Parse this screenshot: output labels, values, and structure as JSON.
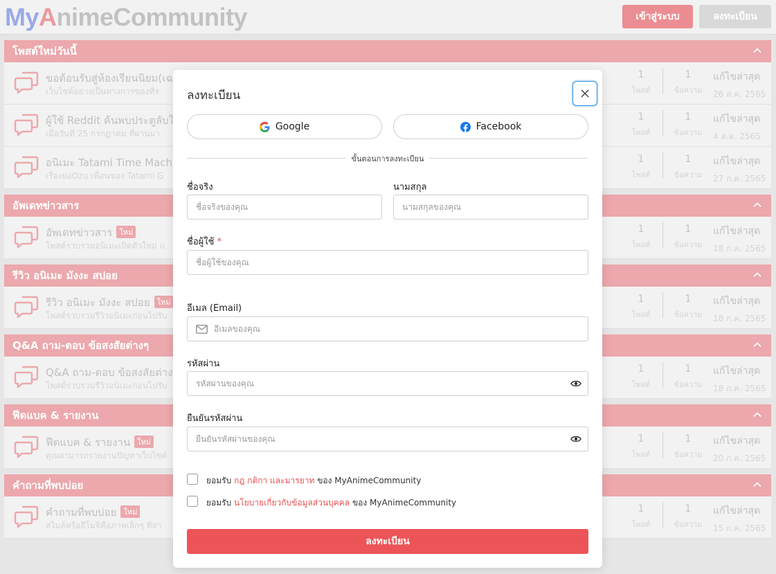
{
  "header": {
    "logo_part1": "My",
    "logo_part2": "A",
    "logo_part3": "nimeCommunity",
    "login_label": "เข้าสู่ระบบ",
    "register_label": "ลงทะเบียน"
  },
  "sections": [
    {
      "title": "โพสต์ใหม่วันนี้",
      "rows": [
        {
          "title": "ขอต้อนรับสู่ห้องเรียนนิยม(เฉ",
          "badge": "",
          "desc": "เว็บไซต์อย่างเป็นทางการของที่ร",
          "posts": "1",
          "posts_label": "โพสต์",
          "msgs": "1",
          "msgs_label": "ข้อความ",
          "last_label": "แก้ไขล่าสุด",
          "date": "26 ส.ค. 2565"
        },
        {
          "title": "ผู้ใช้ Reddit ค้นพบประตูลับใ",
          "badge": "",
          "desc": "เมื่อวันที่ 25 กรกฎาคม ที่ผ่านมา",
          "posts": "1",
          "posts_label": "โพสต์",
          "msgs": "1",
          "msgs_label": "ข้อความ",
          "last_label": "แก้ไขล่าสุด",
          "date": "4 ส.ค. 2565"
        },
        {
          "title": "อนิเมะ Tatami Time Machin",
          "badge": "",
          "desc": "เรื่องย่อOzu เพื่อนของ Tatami G",
          "posts": "1",
          "posts_label": "โพสต์",
          "msgs": "1",
          "msgs_label": "ข้อความ",
          "last_label": "แก้ไขล่าสุด",
          "date": "27 ก.ค. 2565"
        }
      ]
    },
    {
      "title": "อัพเดทข่าวสาร",
      "rows": [
        {
          "title": "อัพเดทข่าวสาร",
          "badge": "ใหม่",
          "desc": "โพสต์รวบรวมอนิเมะเปิดตัวใหม่ แ",
          "posts": "1",
          "posts_label": "โพสต์",
          "msgs": "1",
          "msgs_label": "ข้อความ",
          "last_label": "แก้ไขล่าสุด",
          "date": "18 ก.ค. 2565"
        }
      ]
    },
    {
      "title": "รีวิว อนิเมะ มังงะ สปอย",
      "rows": [
        {
          "title": "รีวิว อนิเมะ มังงะ สปอย",
          "badge": "ใหม่",
          "desc": "โพสต์รวบรวมรีวิวอนิเมะก่อนไปรับ",
          "posts": "1",
          "posts_label": "โพสต์",
          "msgs": "1",
          "msgs_label": "ข้อความ",
          "last_label": "แก้ไขล่าสุด",
          "date": "18 ก.ค. 2565"
        }
      ]
    },
    {
      "title": "Q&A ถาม-ตอบ ข้อสงสัยต่างๆ",
      "rows": [
        {
          "title": "Q&A ถาม-ตอบ ข้อสงสัยต่าง",
          "badge": "",
          "desc": "โพสต์รวบรวมรีวิวอนิเมะก่อนไปรับ",
          "posts": "1",
          "posts_label": "โพสต์",
          "msgs": "1",
          "msgs_label": "ข้อความ",
          "last_label": "แก้ไขล่าสุด",
          "date": "18 ก.ค. 2565"
        }
      ]
    },
    {
      "title": "ฟีดแบค & รายงาน",
      "rows": [
        {
          "title": "ฟีดแบค & รายงาน",
          "badge": "ใหม่",
          "desc": "คุณสามารถรายงานปัญหาเว็บไซต์",
          "posts": "1",
          "posts_label": "โพสต์",
          "msgs": "1",
          "msgs_label": "ข้อความ",
          "last_label": "แก้ไขล่าสุด",
          "date": "20 ก.ค. 2565"
        }
      ]
    },
    {
      "title": "คำถามที่พบบ่อย",
      "rows": [
        {
          "title": "คำถามที่พบบ่อย",
          "badge": "ใหม่",
          "desc": "สไมล์หรืออีโมจิคือภาพเล็กๆ ที่สา",
          "posts": "1",
          "posts_label": "โพสต์",
          "msgs": "1",
          "msgs_label": "ข้อความ",
          "last_label": "แก้ไขล่าสุด",
          "date": "15 ก.ค. 2565"
        }
      ]
    }
  ],
  "modal": {
    "title": "ลงทะเบียน",
    "google_label": "Google",
    "facebook_label": "Facebook",
    "divider_text": "ขั้นตอนการลงทะเบียน",
    "first_name_label": "ชื่อจริง",
    "first_name_placeholder": "ชื่อจริงของคุณ",
    "last_name_label": "นามสกุล",
    "last_name_placeholder": "นามสกุลของคุณ",
    "username_label": "ชื่อผู้ใช้",
    "username_required": "*",
    "username_placeholder": "ชื่อผู้ใช้ของคุณ",
    "email_label": "อีเมล (Email)",
    "email_placeholder": "อีเมลของคุณ",
    "password_label": "รหัสผ่าน",
    "password_placeholder": "รหัสผ่านของคุณ",
    "confirm_label": "ยืนยันรหัสผ่าน",
    "confirm_placeholder": "ยืนยันรหัสผ่านของคุณ",
    "terms_prefix": "ยอมรับ",
    "terms_link": "กฎ กติกา และมารยาท",
    "terms_suffix": "ของ MyAnimeCommunity",
    "privacy_prefix": "ยอมรับ",
    "privacy_link": "นโยบายเกี่ยวกับข้อมูลส่วนบุคคล",
    "privacy_suffix": "ของ MyAnimeCommunity",
    "submit_label": "ลงทะเบียน"
  },
  "colors": {
    "accent": "#ec5458",
    "section_header": "#eca8ac",
    "focus": "#2d8fd8"
  },
  "icons": [
    "chat-bubble-icon",
    "chevron-up-icon",
    "close-icon",
    "google-icon",
    "facebook-icon",
    "mail-icon",
    "eye-icon"
  ]
}
